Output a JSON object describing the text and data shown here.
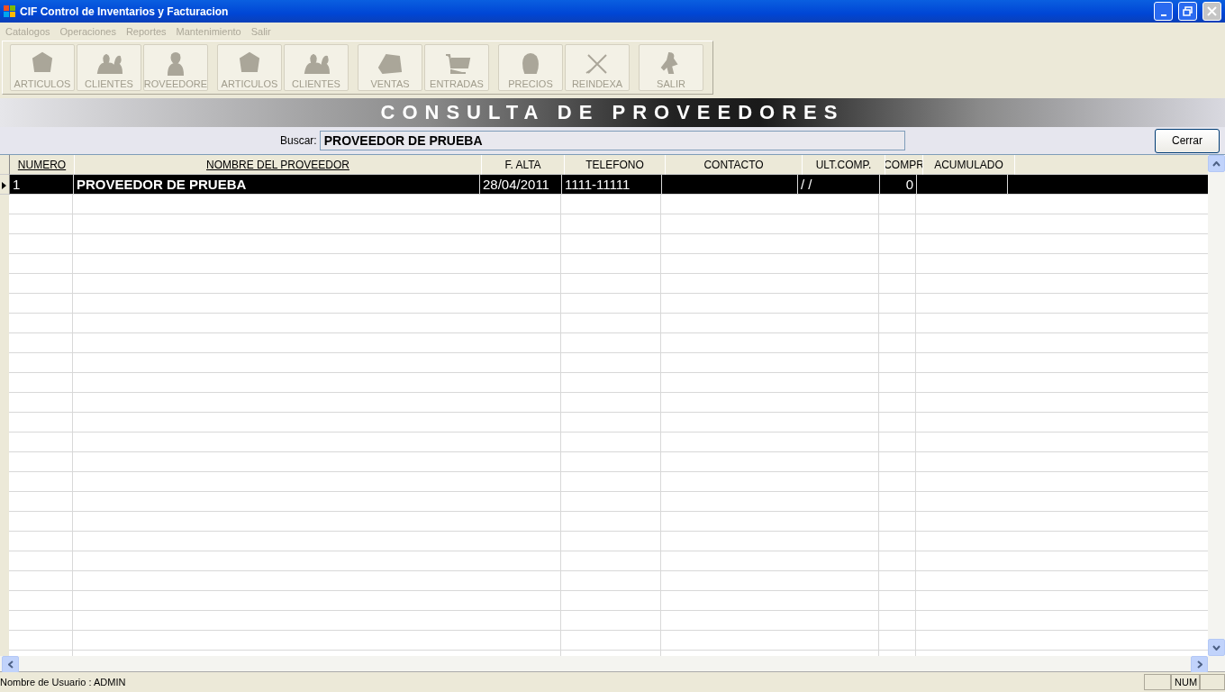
{
  "window": {
    "title": "CIF Control de Inventarios y Facturacion"
  },
  "menu": [
    {
      "label": "Catalogos",
      "disabled": true
    },
    {
      "label": "Operaciones",
      "disabled": true
    },
    {
      "label": "Reportes",
      "disabled": true
    },
    {
      "label": "Mantenimiento",
      "disabled": true
    },
    {
      "label": "Salir",
      "disabled": true
    }
  ],
  "toolbar": [
    {
      "label": "ARTICULOS",
      "disabled": true
    },
    {
      "label": "CLIENTES",
      "disabled": true
    },
    {
      "label": "ROVEEDORE",
      "disabled": true
    },
    {
      "label": "ARTICULOS",
      "disabled": true
    },
    {
      "label": "CLIENTES",
      "disabled": true
    },
    {
      "label": "VENTAS",
      "disabled": true
    },
    {
      "label": "ENTRADAS",
      "disabled": true
    },
    {
      "label": "PRECIOS",
      "disabled": true
    },
    {
      "label": "REINDEXA",
      "disabled": true
    },
    {
      "label": "SALIR",
      "disabled": true
    }
  ],
  "banner": "CONSULTA DE PROVEEDORES",
  "search": {
    "label": "Buscar:",
    "value": "PROVEEDOR DE PRUEBA"
  },
  "close_button": "Cerrar",
  "table": {
    "columns": [
      {
        "label": "NUMERO",
        "underlined": true
      },
      {
        "label": "NOMBRE DEL PROVEEDOR",
        "underlined": true
      },
      {
        "label": "F. ALTA",
        "underlined": false
      },
      {
        "label": "TELEFONO",
        "underlined": false
      },
      {
        "label": "CONTACTO",
        "underlined": false
      },
      {
        "label": "ULT.COMP.",
        "underlined": false
      },
      {
        "label": "COMPR",
        "underlined": false
      },
      {
        "label": "ACUMULADO",
        "underlined": false
      }
    ],
    "rows": [
      {
        "selected": true,
        "cells": [
          "1",
          "PROVEEDOR DE PRUEBA",
          "28/04/2011",
          "1111-11111",
          "",
          "/ /",
          "0",
          ""
        ]
      }
    ]
  },
  "status_bar": {
    "user": "Nombre de Usuario : ADMIN",
    "num": "NUM"
  }
}
